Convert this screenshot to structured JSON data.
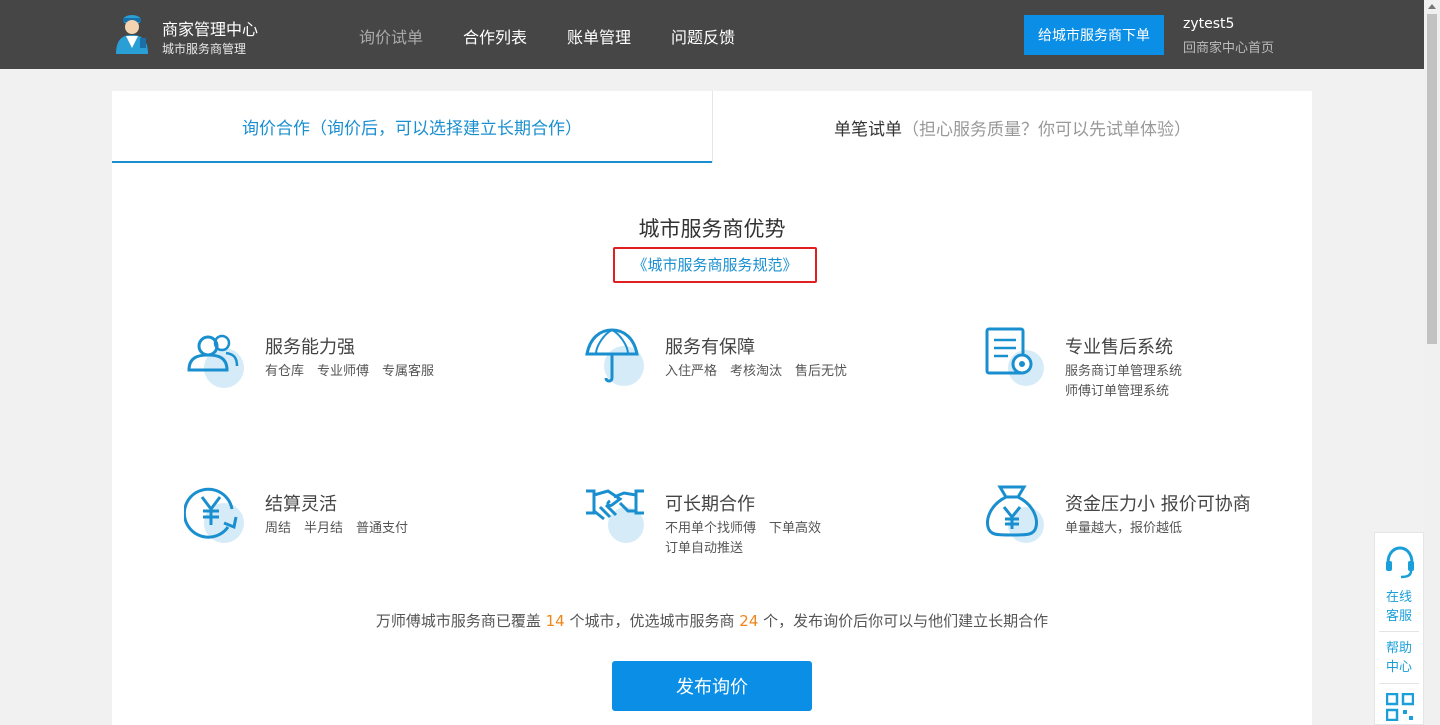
{
  "header": {
    "brand_title": "商家管理中心",
    "brand_sub": "城市服务商管理",
    "nav": [
      {
        "label": "询价试单",
        "active": true
      },
      {
        "label": "合作列表",
        "active": false
      },
      {
        "label": "账单管理",
        "active": false
      },
      {
        "label": "问题反馈",
        "active": false
      }
    ],
    "order_button": "给城市服务商下单",
    "user_name": "zytest5",
    "back_link": "回商家中心首页"
  },
  "tabs": {
    "inquiry": {
      "label": "询价合作（询价后，可以选择建立长期合作）"
    },
    "trial": {
      "label": "单笔试单",
      "hint": "（担心服务质量？你可以先试单体验）"
    }
  },
  "content": {
    "title": "城市服务商优势",
    "spec_link": "《城市服务商服务规范》",
    "features": [
      {
        "icon": "users-icon",
        "title": "服务能力强",
        "desc": [
          "有仓库　专业师傅　专属客服"
        ]
      },
      {
        "icon": "umbrella-icon",
        "title": "服务有保障",
        "desc": [
          "入住严格　考核淘汰　售后无忧"
        ]
      },
      {
        "icon": "document-gear-icon",
        "title": "专业售后系统",
        "desc": [
          "服务商订单管理系统",
          "师傅订单管理系统"
        ]
      },
      {
        "icon": "yuan-refresh-icon",
        "title": "结算灵活",
        "desc": [
          "周结　半月结　普通支付"
        ]
      },
      {
        "icon": "handshake-icon",
        "title": "可长期合作",
        "desc": [
          "不用单个找师傅　下单高效",
          "订单自动推送"
        ]
      },
      {
        "icon": "money-bag-icon",
        "title": "资金压力小 报价可协商",
        "desc": [
          "单量越大，报价越低"
        ]
      }
    ],
    "summary": {
      "pre": "万师傅城市服务商已覆盖",
      "cities": "14",
      "mid": "个城市，优选城市服务商",
      "providers": "24",
      "post": "个，发布询价后你可以与他们建立长期合作"
    },
    "publish_button": "发布询价"
  },
  "side": {
    "online_service": [
      "在线",
      "客服"
    ],
    "help_center": [
      "帮助",
      "中心"
    ]
  },
  "colors": {
    "topbar": "#464646",
    "accent": "#0b8fe6",
    "link": "#1a8fd0",
    "highlight": "#f08519",
    "spec_border": "#e02020"
  }
}
